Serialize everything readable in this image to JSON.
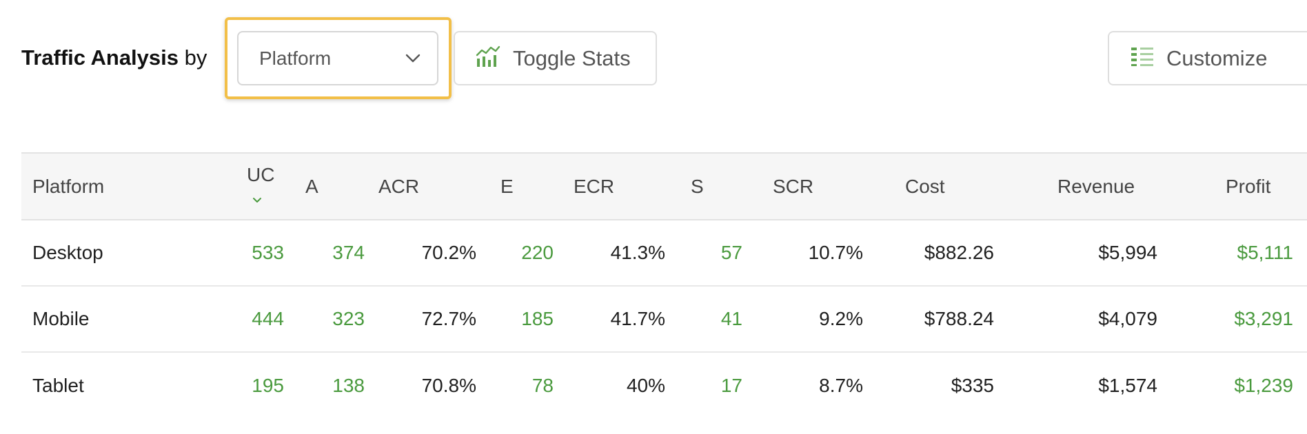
{
  "header": {
    "title_strong": "Traffic Analysis",
    "title_connector": "by",
    "group_select": {
      "value": "Platform"
    },
    "toggle_stats_label": "Toggle Stats",
    "customize_label": "Customize"
  },
  "colors": {
    "accent_green": "#4a9a3e",
    "highlight": "#f2bf48"
  },
  "icons": {
    "select_chevron": "chevron-down-icon",
    "toggle_stats": "bar-chart-icon",
    "customize": "columns-list-icon",
    "sort": "sort-desc-icon"
  },
  "table": {
    "columns": [
      "Platform",
      "UC",
      "A",
      "ACR",
      "E",
      "ECR",
      "S",
      "SCR",
      "Cost",
      "Revenue",
      "Profit"
    ],
    "sorted_column": "UC",
    "rows": [
      [
        "Desktop",
        "533",
        "374",
        "70.2%",
        "220",
        "41.3%",
        "57",
        "10.7%",
        "$882.26",
        "$5,994",
        "$5,111"
      ],
      [
        "Mobile",
        "444",
        "323",
        "72.7%",
        "185",
        "41.7%",
        "41",
        "9.2%",
        "$788.24",
        "$4,079",
        "$3,291"
      ],
      [
        "Tablet",
        "195",
        "138",
        "70.8%",
        "78",
        "40%",
        "17",
        "8.7%",
        "$335",
        "$1,574",
        "$1,239"
      ]
    ]
  }
}
